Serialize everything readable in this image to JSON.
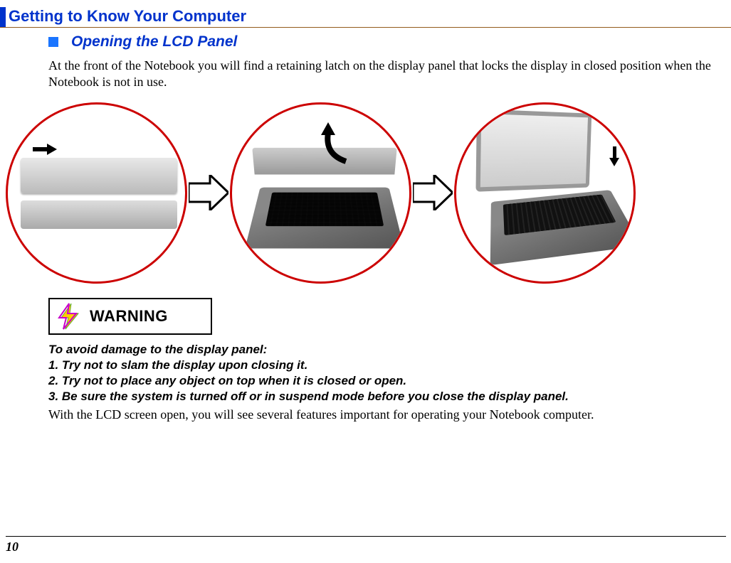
{
  "header": {
    "title": "Getting to Know Your Computer"
  },
  "section": {
    "subheading": "Opening the LCD Panel",
    "intro": "At the front of the Notebook you will find a retaining latch on the display panel that locks the display in closed position when the Notebook is not in use."
  },
  "warning": {
    "label": "WARNING",
    "lead": "To avoid damage to the display panel:",
    "items": [
      "1. Try not to slam the display upon closing it.",
      "2. Try not to place any object on top when it is closed or open.",
      "3. Be sure the system is turned off or in suspend mode before you close the display panel."
    ]
  },
  "closing": "With the LCD screen open, you will see several features important for operating your Notebook computer.",
  "page_number": "10"
}
